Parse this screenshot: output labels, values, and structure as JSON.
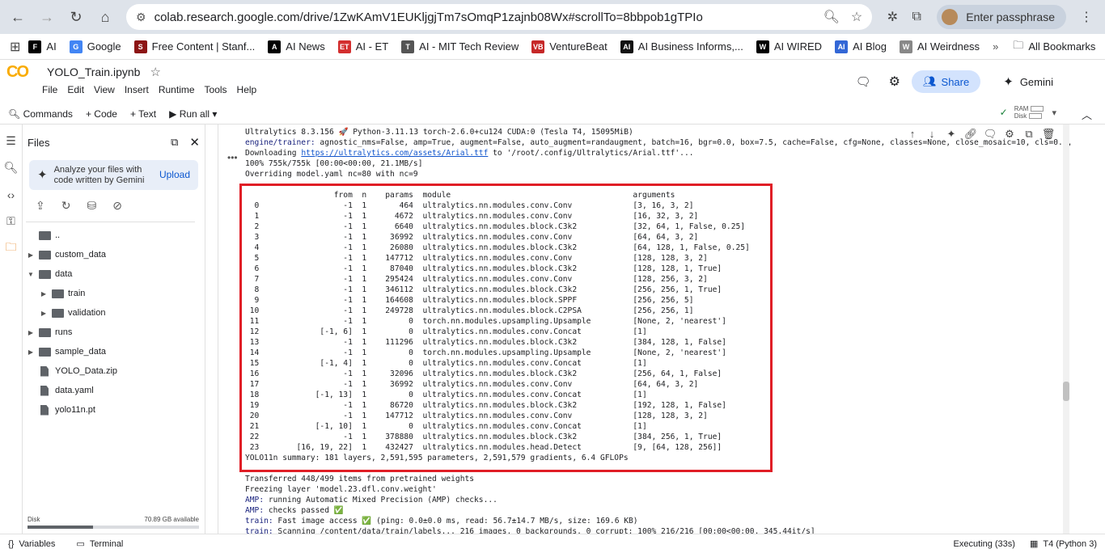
{
  "browser": {
    "url": "colab.research.google.com/drive/1ZwKAmV1EUKljgjTm7sOmqP1zajnb08Wx#scrollTo=8bbpob1gTPIo",
    "profile_label": "Enter passphrase"
  },
  "bookmarks": [
    {
      "label": "AI",
      "color": "#000000",
      "glyph": "F"
    },
    {
      "label": "Google",
      "color": "#4285f4",
      "glyph": "G"
    },
    {
      "label": "Free Content | Stanf...",
      "color": "#8c1515",
      "glyph": "S"
    },
    {
      "label": "AI News",
      "color": "#000000",
      "glyph": "A"
    },
    {
      "label": "AI - ET",
      "color": "#d32f2f",
      "glyph": "ET"
    },
    {
      "label": "AI - MIT Tech Review",
      "color": "#555555",
      "glyph": "T"
    },
    {
      "label": "VentureBeat",
      "color": "#c62828",
      "glyph": "VB"
    },
    {
      "label": "AI Business Informs,...",
      "color": "#111111",
      "glyph": "AI"
    },
    {
      "label": "AI WIRED",
      "color": "#000000",
      "glyph": "W"
    },
    {
      "label": "AI Blog",
      "color": "#3367d6",
      "glyph": "AI"
    },
    {
      "label": "AI Weirdness",
      "color": "#888888",
      "glyph": "W"
    }
  ],
  "all_bookmarks": "All Bookmarks",
  "colab": {
    "title": "YOLO_Train.ipynb",
    "menus": [
      "File",
      "Edit",
      "View",
      "Insert",
      "Runtime",
      "Tools",
      "Help"
    ],
    "share": "Share",
    "gemini": "Gemini",
    "toolbar": {
      "commands": "Commands",
      "code": "+ Code",
      "text": "+ Text",
      "run_all": "Run all",
      "ram": "RAM",
      "disk": "Disk"
    }
  },
  "files": {
    "title": "Files",
    "analyze_text": "Analyze your files with code written by Gemini",
    "upload": "Upload",
    "tree": [
      {
        "name": "..",
        "type": "folder",
        "depth": 0,
        "caret": ""
      },
      {
        "name": "custom_data",
        "type": "folder",
        "depth": 0,
        "caret": "▶"
      },
      {
        "name": "data",
        "type": "folder",
        "depth": 0,
        "caret": "▼"
      },
      {
        "name": "train",
        "type": "folder",
        "depth": 1,
        "caret": "▶"
      },
      {
        "name": "validation",
        "type": "folder",
        "depth": 1,
        "caret": "▶"
      },
      {
        "name": "runs",
        "type": "folder",
        "depth": 0,
        "caret": "▶"
      },
      {
        "name": "sample_data",
        "type": "folder",
        "depth": 0,
        "caret": "▶"
      },
      {
        "name": "YOLO_Data.zip",
        "type": "file",
        "depth": 0,
        "caret": ""
      },
      {
        "name": "data.yaml",
        "type": "file",
        "depth": 0,
        "caret": ""
      },
      {
        "name": "yolo11n.pt",
        "type": "file",
        "depth": 0,
        "caret": ""
      }
    ],
    "disk_label": "Disk",
    "disk_avail": "70.89 GB available"
  },
  "output": {
    "header_lines": [
      "Ultralytics 8.3.156 🚀 Python-3.11.13 torch-2.6.0+cu124 CUDA:0 (Tesla T4, 15095MiB)",
      "engine/trainer: agnostic_nms=False, amp=True, augment=False, auto_augment=randaugment, batch=16, bgr=0.0, box=7.5, cache=False, cfg=None, classes=None, close_mosaic=10, cls=0.5,",
      "Downloading https://ultralytics.com/assets/Arial.ttf to '/root/.config/Ultralytics/Arial.ttf'...",
      "100% 755k/755k [00:00<00:00, 21.1MB/s]",
      "Overriding model.yaml nc=80 with nc=9"
    ],
    "table_header": "                   from  n    params  module                                       arguments",
    "layers": [
      "  0                  -1  1       464  ultralytics.nn.modules.conv.Conv             [3, 16, 3, 2]",
      "  1                  -1  1      4672  ultralytics.nn.modules.conv.Conv             [16, 32, 3, 2]",
      "  2                  -1  1      6640  ultralytics.nn.modules.block.C3k2            [32, 64, 1, False, 0.25]",
      "  3                  -1  1     36992  ultralytics.nn.modules.conv.Conv             [64, 64, 3, 2]",
      "  4                  -1  1     26080  ultralytics.nn.modules.block.C3k2            [64, 128, 1, False, 0.25]",
      "  5                  -1  1    147712  ultralytics.nn.modules.conv.Conv             [128, 128, 3, 2]",
      "  6                  -1  1     87040  ultralytics.nn.modules.block.C3k2            [128, 128, 1, True]",
      "  7                  -1  1    295424  ultralytics.nn.modules.conv.Conv             [128, 256, 3, 2]",
      "  8                  -1  1    346112  ultralytics.nn.modules.block.C3k2            [256, 256, 1, True]",
      "  9                  -1  1    164608  ultralytics.nn.modules.block.SPPF            [256, 256, 5]",
      " 10                  -1  1    249728  ultralytics.nn.modules.block.C2PSA           [256, 256, 1]",
      " 11                  -1  1         0  torch.nn.modules.upsampling.Upsample         [None, 2, 'nearest']",
      " 12             [-1, 6]  1         0  ultralytics.nn.modules.conv.Concat           [1]",
      " 13                  -1  1    111296  ultralytics.nn.modules.block.C3k2            [384, 128, 1, False]",
      " 14                  -1  1         0  torch.nn.modules.upsampling.Upsample         [None, 2, 'nearest']",
      " 15             [-1, 4]  1         0  ultralytics.nn.modules.conv.Concat           [1]",
      " 16                  -1  1     32096  ultralytics.nn.modules.block.C3k2            [256, 64, 1, False]",
      " 17                  -1  1     36992  ultralytics.nn.modules.conv.Conv             [64, 64, 3, 2]",
      " 18            [-1, 13]  1         0  ultralytics.nn.modules.conv.Concat           [1]",
      " 19                  -1  1     86720  ultralytics.nn.modules.block.C3k2            [192, 128, 1, False]",
      " 20                  -1  1    147712  ultralytics.nn.modules.conv.Conv             [128, 128, 3, 2]",
      " 21            [-1, 10]  1         0  ultralytics.nn.modules.conv.Concat           [1]",
      " 22                  -1  1    378880  ultralytics.nn.modules.block.C3k2            [384, 256, 1, True]",
      " 23        [16, 19, 22]  1    432427  ultralytics.nn.modules.head.Detect           [9, [64, 128, 256]]"
    ],
    "summary": "YOLO11n summary: 181 layers, 2,591,595 parameters, 2,591,579 gradients, 6.4 GFLOPs",
    "footer_lines": [
      "Transferred 448/499 items from pretrained weights",
      "Freezing layer 'model.23.dfl.conv.weight'",
      "AMP: running Automatic Mixed Precision (AMP) checks...",
      "AMP: checks passed ✅",
      "train: Fast image access ✅ (ping: 0.0±0.0 ms, read: 56.7±14.7 MB/s, size: 169.6 KB)",
      "train: Scanning /content/data/train/labels... 216 images, 0 backgrounds, 0 corrupt: 100% 216/216 [00:00<00:00, 345.44it/s]"
    ]
  },
  "status": {
    "variables": "Variables",
    "terminal": "Terminal",
    "executing": "Executing (33s)",
    "runtime": "T4 (Python 3)"
  }
}
